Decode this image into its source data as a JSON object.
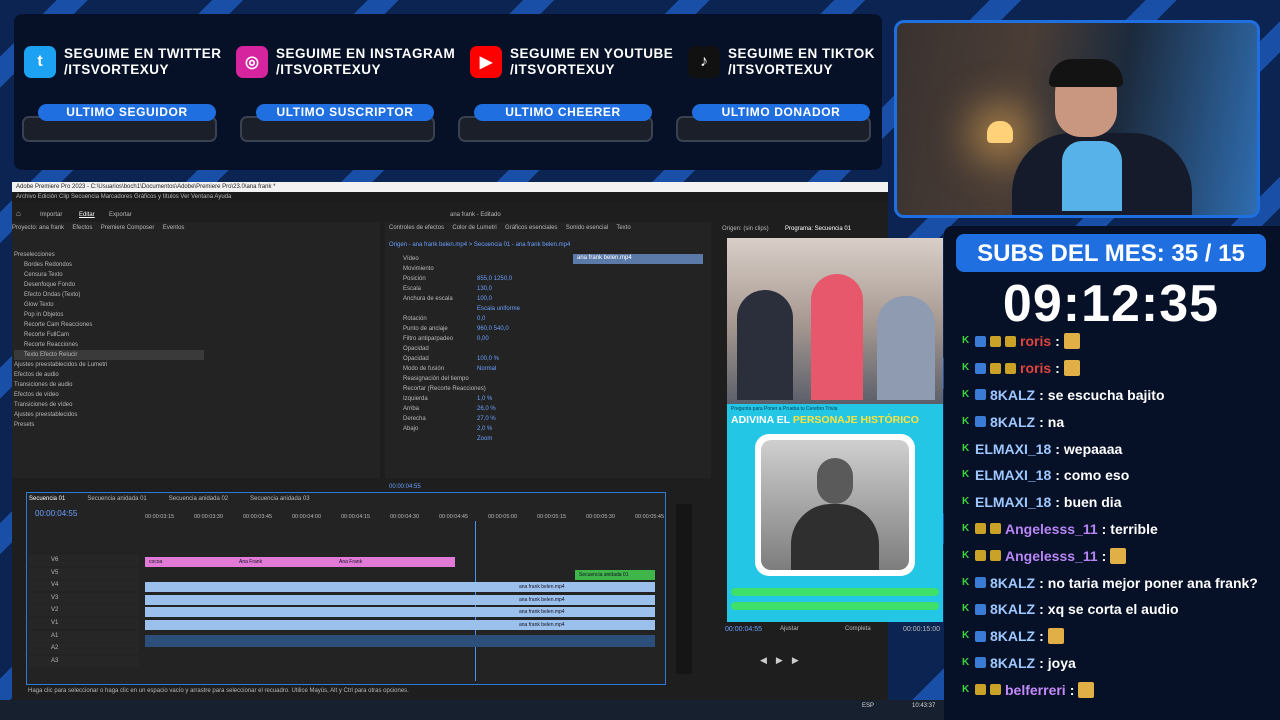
{
  "social": [
    {
      "icon": "twitter-icon",
      "glyph": "t",
      "color": "#1da1f2",
      "line1": "SEGUIME EN TWITTER",
      "line2": "/ITSVORTEXUY"
    },
    {
      "icon": "instagram-icon",
      "glyph": "◎",
      "color": "#d6249f",
      "line1": "SEGUIME EN INSTAGRAM",
      "line2": "/ITSVORTEXUY"
    },
    {
      "icon": "youtube-icon",
      "glyph": "▶",
      "color": "#ff0000",
      "line1": "SEGUIME EN YOUTUBE",
      "line2": "/ITSVORTEXUY"
    },
    {
      "icon": "tiktok-icon",
      "glyph": "♪",
      "color": "#111111",
      "line1": "SEGUIME EN TIKTOK",
      "line2": "/ITSVORTEXUY"
    }
  ],
  "last": [
    "ULTIMO SEGUIDOR",
    "ULTIMO SUSCRIPTOR",
    "ULTIMO CHEERER",
    "ULTIMO DONADOR"
  ],
  "premiere": {
    "title": "Adobe Premiere Pro 2023 - C:\\Usuarios\\boch1\\Documentos\\Adobe\\Premiere Pro\\23.0\\ana frank *",
    "menu": "Archivo   Edición   Clip   Secuencia   Marcadores   Gráficos y títulos   Ver   Ventana   Ayuda",
    "workspace_tabs": [
      "Inicio",
      "Importar",
      "Editar",
      "Exportar"
    ],
    "project_name": "ana frank - Editado",
    "effects_tabs": "Proyecto: ana frank     Efectos     Premiere Composer     Eventos",
    "effects_list": [
      "Preselecciones",
      "Bordes Redondos",
      "Censura Texto",
      "Desenfoque Fondo",
      "Efecto Ondas (Texto)",
      "Glow Texto",
      "Pop in Objetos",
      "Recorte Cam Reacciones",
      "Recorte FullCam",
      "Recorte Reacciones",
      "Texto Efecto Relucir",
      "Ajustes preestablecidos de Lumetri",
      "Efectos de audio",
      "Transiciones de audio",
      "Efectos de vídeo",
      "Transiciones de vídeo",
      "Ajustes preestablecidos",
      "Presets"
    ],
    "controls_tabs": "Controles de efectos     Color de Lumetri     Gráficos esenciales     Sonido esencial     Texto",
    "controls_source": "Origen - ana frank belen.mp4  >  Secuencia 01 - ana frank belen.mp4",
    "controls_rows": [
      [
        "Vídeo",
        ""
      ],
      [
        "Movimiento",
        ""
      ],
      [
        "Posición",
        "855,0   1250,0"
      ],
      [
        "Escala",
        "130,0"
      ],
      [
        "Anchura de escala",
        "100,0"
      ],
      [
        "",
        "Escala uniforme"
      ],
      [
        "Rotación",
        "0,0"
      ],
      [
        "Punto de anclaje",
        "960,0   540,0"
      ],
      [
        "Filtro antiparpadeo",
        "0,00"
      ],
      [
        "Opacidad",
        ""
      ],
      [
        "Opacidad",
        "100,0 %"
      ],
      [
        "Modo de fusión",
        "Normal"
      ],
      [
        "Reasignación del tiempo",
        ""
      ],
      [
        "Recortar (Recorte Reacciones)",
        ""
      ],
      [
        "Izquierda",
        "1,0 %"
      ],
      [
        "Arriba",
        "26,0 %"
      ],
      [
        "Derecha",
        "27,0 %"
      ],
      [
        "Abajo",
        "2,0 %"
      ],
      [
        "",
        "Zoom"
      ]
    ],
    "clip_label": "ana frank belen.mp4",
    "controls_time": "00:00:04:55",
    "source_tab": "Origen: (sin clips)",
    "program_tab": "Programa: Secuencia 01",
    "seq_tabs": [
      "Secuencia 01",
      "Secuencia anidada 01",
      "Secuencia anidada 02",
      "Secuencia anidada 03"
    ],
    "timecode": "00:00:04:55",
    "ruler": [
      "00:00:03:15",
      "00:00:03:30",
      "00:00:03:45",
      "00:00:04:00",
      "00:00:04:15",
      "00:00:04:30",
      "00:00:04:45",
      "00:00:05:00",
      "00:00:05:15",
      "00:00:05:30",
      "00:00:05:45"
    ],
    "tracks": [
      "V6",
      "V5",
      "V4",
      "V3",
      "V2",
      "V1",
      "A1",
      "A2",
      "A3"
    ],
    "pink_clips": [
      "cocoa",
      "Ana Frank",
      "Ana Frank"
    ],
    "clip_names": [
      "ana frank belen.mp4",
      "ana frank belen.mp4",
      "ana frank belen.mp4",
      "ana frank belen.mp4"
    ],
    "nested": "Secuencia anidada 01",
    "program_time": "00:00:04:55",
    "fit": "Ajustar",
    "quality": "Completa",
    "duration": "00:00:15:00",
    "status": "Haga clic para seleccionar o haga clic en un espacio vacío y arrastre para seleccionar el recuadro. Utilice Mayús, Alt y Ctrl para otras opciones.",
    "preview_banner_small": "Pregunta para Poner a Prueba tu Cerebro   Trivia",
    "preview_title_a": "ADIVINA EL ",
    "preview_title_b": "PERSONAJE HISTÓRICO",
    "taskbar_lang": "ESP",
    "taskbar_time": "10:43:37"
  },
  "subs": "SUBS DEL MES: 35 / 15",
  "timer": "09:12:35",
  "chat": [
    {
      "user": "roris",
      "color": "#e0443e",
      "msg": "",
      "emote": true,
      "badges": [
        "#3a7bd5",
        "#c9a227",
        "#c9a227"
      ]
    },
    {
      "user": "roris",
      "color": "#e0443e",
      "msg": "",
      "emote": true,
      "badges": [
        "#3a7bd5",
        "#c9a227",
        "#c9a227"
      ]
    },
    {
      "user": "8KALZ",
      "color": "#9ec7ff",
      "msg": "se escucha bajito",
      "emote": false,
      "badges": [
        "#3a7bd5"
      ]
    },
    {
      "user": "8KALZ",
      "color": "#9ec7ff",
      "msg": "na",
      "emote": false,
      "badges": [
        "#3a7bd5"
      ]
    },
    {
      "user": "ELMAXI_18",
      "color": "#9ec7ff",
      "msg": "wepaaaa",
      "emote": false,
      "badges": []
    },
    {
      "user": "ELMAXI_18",
      "color": "#9ec7ff",
      "msg": "como eso",
      "emote": false,
      "badges": []
    },
    {
      "user": "ELMAXI_18",
      "color": "#9ec7ff",
      "msg": "buen dia",
      "emote": false,
      "badges": []
    },
    {
      "user": "Angelesss_11",
      "color": "#b985f6",
      "msg": "terrible",
      "emote": false,
      "badges": [
        "#c9a227",
        "#c9a227"
      ]
    },
    {
      "user": "Angelesss_11",
      "color": "#b985f6",
      "msg": "",
      "emote": true,
      "badges": [
        "#c9a227",
        "#c9a227"
      ]
    },
    {
      "user": "8KALZ",
      "color": "#9ec7ff",
      "msg": "no taria mejor poner ana frank?",
      "emote": false,
      "badges": [
        "#3a7bd5"
      ]
    },
    {
      "user": "8KALZ",
      "color": "#9ec7ff",
      "msg": "xq se corta el audio",
      "emote": false,
      "badges": [
        "#3a7bd5"
      ]
    },
    {
      "user": "8KALZ",
      "color": "#9ec7ff",
      "msg": "",
      "emote": true,
      "badges": [
        "#3a7bd5"
      ]
    },
    {
      "user": "8KALZ",
      "color": "#9ec7ff",
      "msg": "joya",
      "emote": false,
      "badges": [
        "#3a7bd5"
      ]
    },
    {
      "user": "belferreri",
      "color": "#c58af9",
      "msg": "",
      "emote": true,
      "badges": [
        "#c9a227",
        "#c9a227"
      ]
    }
  ]
}
